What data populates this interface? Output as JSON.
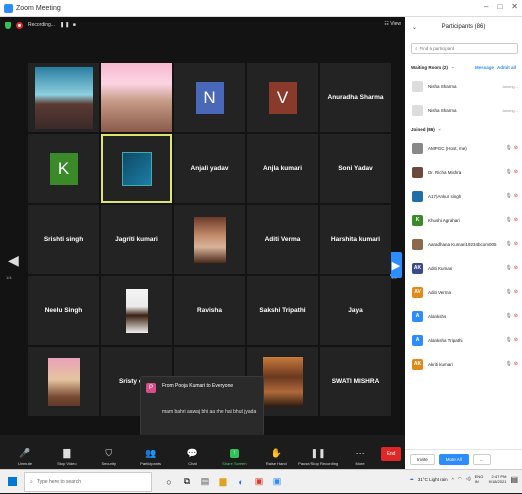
{
  "window": {
    "title": "Zoom Meeting"
  },
  "topbar": {
    "recording_label": "Recording...",
    "pause_glyph": "❚❚ ■",
    "view_label": "View"
  },
  "grid": {
    "tiles": [
      {
        "label": "",
        "kind": "image",
        "image": "person1"
      },
      {
        "label": "",
        "kind": "image",
        "image": "person2"
      },
      {
        "label": "N",
        "kind": "avatar",
        "color": "#4a68b8"
      },
      {
        "label": "V",
        "kind": "avatar",
        "color": "#8a3a2a"
      },
      {
        "label": "Anuradha Sharma",
        "kind": "name"
      },
      {
        "label": "K",
        "kind": "avatar",
        "color": "#3a8a2a"
      },
      {
        "label": "",
        "kind": "image",
        "image": "blue",
        "active": true
      },
      {
        "label": "Anjali yadav",
        "kind": "name"
      },
      {
        "label": "Anjla kumari",
        "kind": "name"
      },
      {
        "label": "Soni Yadav",
        "kind": "name"
      },
      {
        "label": "Srishti singh",
        "kind": "name"
      },
      {
        "label": "Jagriti kumari",
        "kind": "name"
      },
      {
        "label": "",
        "kind": "image",
        "image": "person3"
      },
      {
        "label": "Aditi Verma",
        "kind": "name"
      },
      {
        "label": "Harshita kumari",
        "kind": "name"
      },
      {
        "label": "Neelu Singh",
        "kind": "name"
      },
      {
        "label": "",
        "kind": "image",
        "image": "person4"
      },
      {
        "label": "Ravisha",
        "kind": "name"
      },
      {
        "label": "Sakshi Tripathi",
        "kind": "name"
      },
      {
        "label": "Jaya",
        "kind": "name"
      },
      {
        "label": "",
        "kind": "image",
        "image": "person5"
      },
      {
        "label": "Sristy chau",
        "kind": "name"
      },
      {
        "label": "",
        "kind": "blank"
      },
      {
        "label": "",
        "kind": "image",
        "image": "person6"
      },
      {
        "label": "SWATI MISHRA",
        "kind": "name"
      }
    ],
    "page_left": "1/4",
    "page_right": "1/4"
  },
  "chat_popup": {
    "avatar_letter": "P",
    "from": "From Pooja Kumari to Everyone",
    "message": "mam bahri aawaj bhi aa rhe hai bhut jyada"
  },
  "toolbar": {
    "items": [
      {
        "label": "Unmute",
        "icon": "mic-muted-icon",
        "glyph": "🎤"
      },
      {
        "label": "Stop Video",
        "icon": "video-icon",
        "glyph": "▇"
      },
      {
        "label": "Security",
        "icon": "security-shield-icon",
        "glyph": "⛉"
      },
      {
        "label": "Participants",
        "icon": "participants-icon",
        "glyph": "👥"
      },
      {
        "label": "Chat",
        "icon": "chat-icon",
        "glyph": "💬"
      },
      {
        "label": "Share Screen",
        "icon": "share-screen-icon",
        "glyph": "↑"
      },
      {
        "label": "Raise Hand",
        "icon": "raise-hand-icon",
        "glyph": "✋"
      },
      {
        "label": "Pause/Stop Recording",
        "icon": "recording-icon",
        "glyph": "❚❚"
      },
      {
        "label": "More",
        "icon": "more-icon",
        "glyph": "⋯"
      }
    ],
    "end_label": "End",
    "participants_count": "86"
  },
  "panel": {
    "title": "Participants (86)",
    "search_placeholder": "Find a participant",
    "waiting_room": "Waiting Room (2)",
    "message_label": "Message",
    "admit_all_label": "Admit all",
    "waiting": [
      {
        "name": "Nisha Sharma",
        "status": "Joining..."
      },
      {
        "name": "Nisha Sharma",
        "status": "Joining..."
      }
    ],
    "joined_label": "Joined (86)",
    "participants": [
      {
        "name": "AMPGC (Host, me)",
        "initial": "",
        "color": "#888888"
      },
      {
        "name": "Dr. Richa Mishra",
        "initial": "",
        "color": "#6a4a3a"
      },
      {
        "name": "A17)Ankur singh",
        "initial": "",
        "color": "#1e6fa6"
      },
      {
        "name": "Khushi Agrahari",
        "initial": "K",
        "color": "#3a8a2a"
      },
      {
        "name": "Aaradhana Kumari19234bcom005",
        "initial": "",
        "color": "#8a6a4a"
      },
      {
        "name": "Aditi Kumari",
        "initial": "AK",
        "color": "#3a4a8a"
      },
      {
        "name": "Aditi Verma",
        "initial": "AV",
        "color": "#e08a1a"
      },
      {
        "name": "Alankshs",
        "initial": "A",
        "color": "#2D8CFF"
      },
      {
        "name": "Alanksha Tripathi",
        "initial": "A",
        "color": "#2D8CFF"
      },
      {
        "name": "Akriti kumari",
        "initial": "AK",
        "color": "#e08a1a"
      }
    ],
    "invite_label": "Invite",
    "mute_all_label": "Mute All",
    "more_label": "..."
  },
  "taskbar": {
    "search_placeholder": "Type here to search",
    "weather": "31°C Light rain",
    "lang": "ENG IN",
    "time": "2:47 PM",
    "date": "9/18/2021"
  }
}
